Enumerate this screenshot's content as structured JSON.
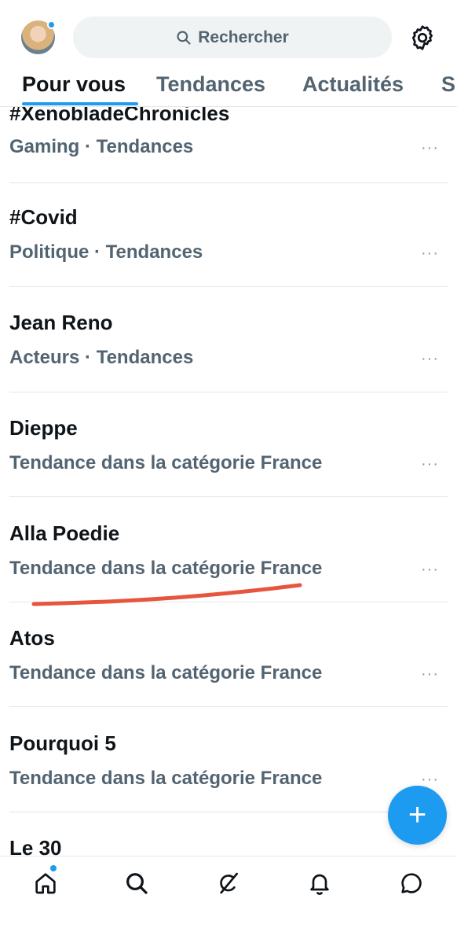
{
  "search": {
    "placeholder": "Rechercher"
  },
  "tabs": [
    "Pour vous",
    "Tendances",
    "Actualités",
    "S"
  ],
  "trends": [
    {
      "title": "#XenobladeChronicles",
      "meta": "Gaming · Tendances"
    },
    {
      "title": "#Covid",
      "meta": "Politique · Tendances"
    },
    {
      "title": "Jean Reno",
      "meta": "Acteurs · Tendances"
    },
    {
      "title": "Dieppe",
      "meta": "Tendance dans la catégorie France"
    },
    {
      "title": "Alla Poedie",
      "meta": "Tendance dans la catégorie France"
    },
    {
      "title": "Atos",
      "meta": "Tendance dans la catégorie France"
    },
    {
      "title": "Pourquoi 5",
      "meta": "Tendance dans la catégorie France"
    },
    {
      "title": "Le 30",
      "meta": ""
    }
  ],
  "more_label": "···",
  "fab_label": "+",
  "colors": {
    "accent": "#1d9bf0",
    "annotation": "#e8553f",
    "muted": "#536471"
  },
  "nav_icons": [
    "home-icon",
    "search-icon",
    "grok-icon",
    "bell-icon",
    "messages-icon"
  ]
}
